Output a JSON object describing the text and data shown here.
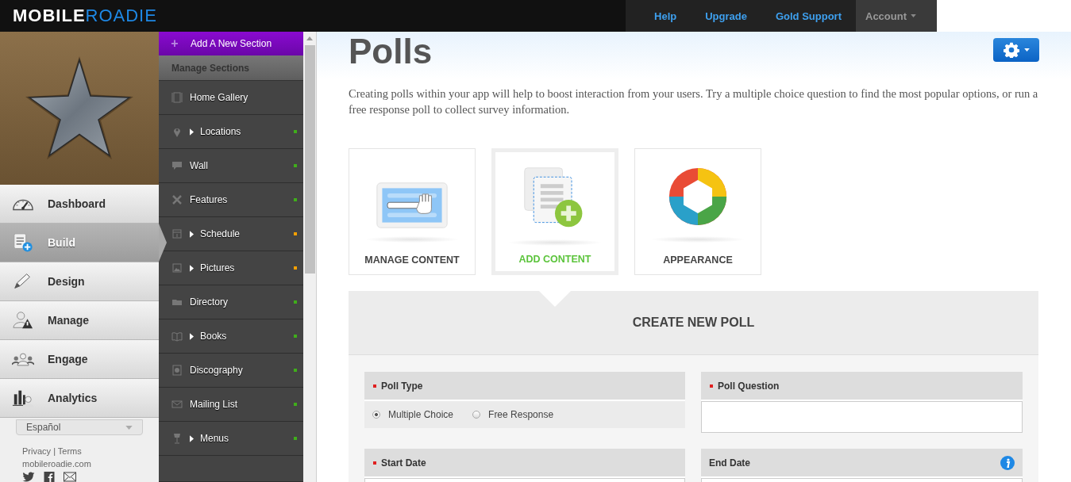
{
  "top_bar": {
    "logo_bold": "MOBILE",
    "logo_light": "ROADIE",
    "links": [
      {
        "label": "Help"
      },
      {
        "label": "Upgrade"
      },
      {
        "label": "Gold Support"
      }
    ],
    "account": {
      "label": "Account"
    }
  },
  "app_nav": {
    "items": [
      {
        "label": "Dashboard",
        "selected": false
      },
      {
        "label": "Build",
        "selected": true
      },
      {
        "label": "Design",
        "selected": false
      },
      {
        "label": "Manage",
        "selected": false
      },
      {
        "label": "Engage",
        "selected": false
      },
      {
        "label": "Analytics",
        "selected": false
      }
    ]
  },
  "language_select": {
    "value": "Español"
  },
  "footer": {
    "privacy": "Privacy",
    "separator": "|",
    "terms": "Terms",
    "site": "mobileroadie.com"
  },
  "sections": {
    "add_label": "Add A New Section",
    "plus": "+",
    "heading": "Manage Sections",
    "items": [
      {
        "label": "Home Gallery",
        "expandable": false
      },
      {
        "label": "Locations",
        "expandable": true,
        "color": "#3fae1a"
      },
      {
        "label": "Wall",
        "expandable": false,
        "color": "#3fae1a"
      },
      {
        "label": "Features",
        "expandable": false,
        "color": "#3fae1a"
      },
      {
        "label": "Schedule",
        "expandable": true,
        "color": "#f5a000"
      },
      {
        "label": "Pictures",
        "expandable": true,
        "color": "#f5a000"
      },
      {
        "label": "Directory",
        "expandable": false,
        "color": "#3fae1a"
      },
      {
        "label": "Books",
        "expandable": true,
        "color": "#3fae1a"
      },
      {
        "label": "Discography",
        "expandable": false,
        "color": "#3fae1a"
      },
      {
        "label": "Mailing List",
        "expandable": false,
        "color": "#3fae1a"
      },
      {
        "label": "Menus",
        "expandable": true,
        "color": "#3fae1a"
      }
    ]
  },
  "page": {
    "title": "Polls",
    "description": "Creating polls within your app will help to boost interaction from your users. Try a multiple choice question to find the most popular options, or run a free response poll to collect survey information."
  },
  "tiles": [
    {
      "label": "MANAGE CONTENT",
      "selected": false
    },
    {
      "label": "ADD CONTENT",
      "selected": true
    },
    {
      "label": "APPEARANCE",
      "selected": false
    }
  ],
  "form": {
    "title": "CREATE NEW POLL",
    "fields": [
      {
        "label": "Poll Type",
        "required": true,
        "kind": "radio",
        "options": [
          {
            "label": "Multiple Choice",
            "selected": true
          },
          {
            "label": "Free Response",
            "selected": false
          }
        ]
      },
      {
        "label": "Poll Question",
        "required": true,
        "kind": "text"
      },
      {
        "label": "Start Date",
        "required": true,
        "kind": "cut"
      },
      {
        "label": "End Date",
        "required": false,
        "kind": "cut",
        "info": true
      }
    ]
  }
}
